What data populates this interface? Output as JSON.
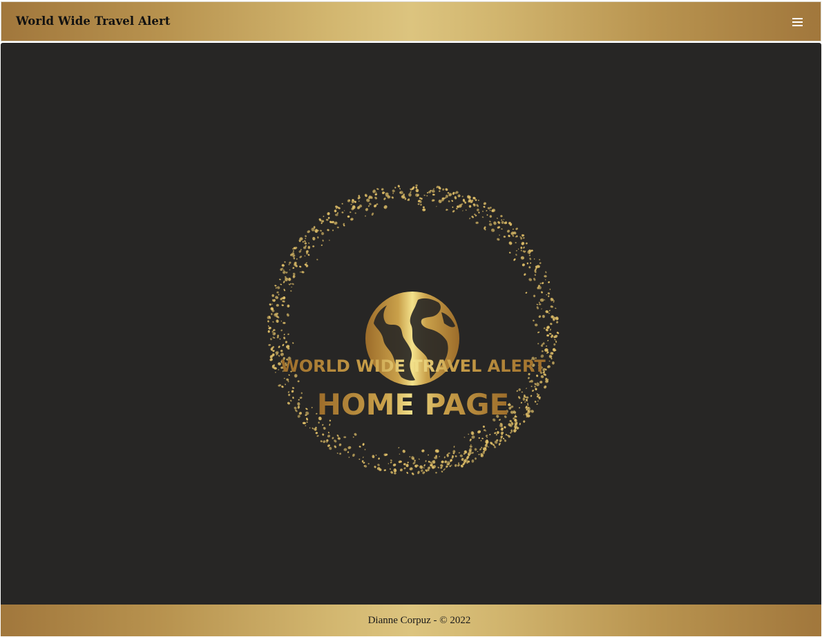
{
  "navbar": {
    "brand": "World Wide Travel Alert",
    "menu_icon": "hamburger-icon"
  },
  "hero": {
    "title": "WORLD WIDE TRAVEL ALERT",
    "subtitle": "HOME PAGE",
    "emblem_icon": "globe-icon"
  },
  "footer": {
    "text": "Dianne Corpuz - © 2022"
  },
  "colors": {
    "gold_dark": "#a1773c",
    "gold_light": "#dcc47f",
    "background": "#272625"
  }
}
